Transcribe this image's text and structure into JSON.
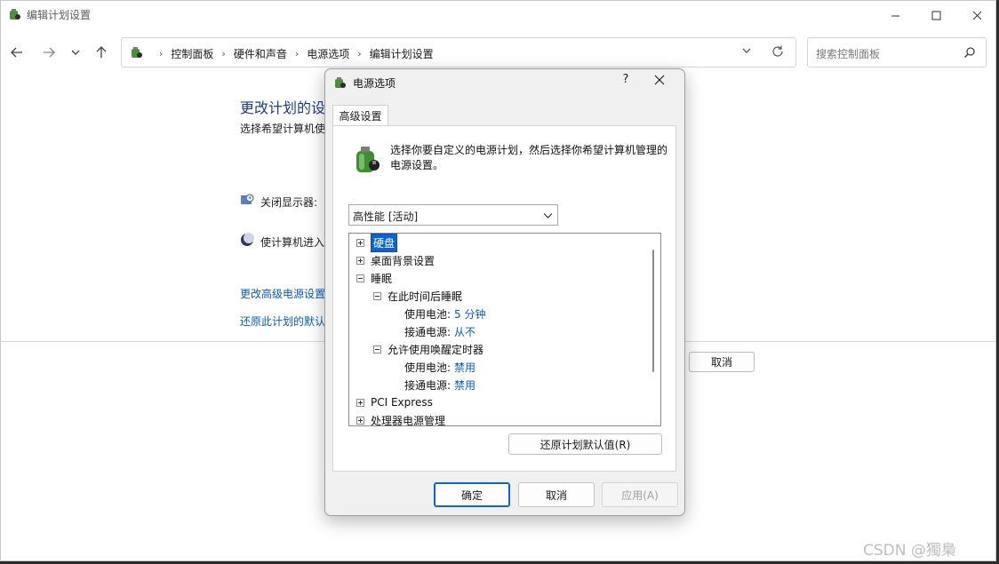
{
  "window": {
    "title": "编辑计划设置"
  },
  "address": {
    "crumbs": [
      "控制面板",
      "硬件和声音",
      "电源选项",
      "编辑计划设置"
    ]
  },
  "search": {
    "placeholder": "搜索控制面板"
  },
  "content": {
    "title": "更改计划的设",
    "subtitle": "选择希望计算机使",
    "display_off_label": "关闭显示器:",
    "sleep_label": "使计算机进入",
    "advanced_link": "更改高级电源设置",
    "restore_link": "还原此计划的默认",
    "cancel_button": "取消"
  },
  "dialog": {
    "title": "电源选项",
    "help": "?",
    "tab_label": "高级设置",
    "description": "选择你要自定义的电源计划，然后选择你希望计算机管理的电源设置。",
    "plan_selected": "高性能 [活动]",
    "tree": {
      "hard_disk": "硬盘",
      "desktop_bg": "桌面背景设置",
      "sleep": "睡眠",
      "sleep_after": "在此时间后睡眠",
      "sleep_battery_label": "使用电池:",
      "sleep_battery_value": "5 分钟",
      "sleep_plugged_label": "接通电源:",
      "sleep_plugged_value": "从不",
      "wake_timers": "允许使用唤醒定时器",
      "wake_battery_label": "使用电池:",
      "wake_battery_value": "禁用",
      "wake_plugged_label": "接通电源:",
      "wake_plugged_value": "禁用",
      "pci_express": "PCI Express",
      "processor": "处理器电源管理"
    },
    "restore_defaults": "还原计划默认值(R)",
    "ok": "确定",
    "cancel": "取消",
    "apply": "应用(A)"
  },
  "watermark": "CSDN @獨梟",
  "colors": {
    "accent": "#0a64d6",
    "link": "#0a5cba",
    "title_blue": "#1f3b8e"
  }
}
